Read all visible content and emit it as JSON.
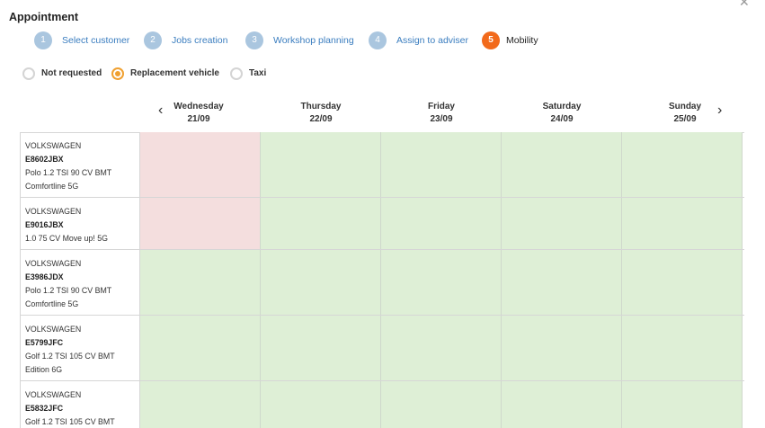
{
  "header": {
    "title": "Appointment",
    "close_icon": "close-icon"
  },
  "steps": [
    {
      "num": "1",
      "label": "Select customer",
      "active": false
    },
    {
      "num": "2",
      "label": "Jobs creation",
      "active": false
    },
    {
      "num": "3",
      "label": "Workshop planning",
      "active": false
    },
    {
      "num": "4",
      "label": "Assign to adviser",
      "active": false
    },
    {
      "num": "5",
      "label": "Mobility",
      "active": true
    }
  ],
  "mobility_options": [
    {
      "label": "Not requested",
      "selected": false
    },
    {
      "label": "Replacement vehicle",
      "selected": true
    },
    {
      "label": "Taxi",
      "selected": false
    }
  ],
  "calendar": {
    "prev_icon": "chevron-left-icon",
    "next_icon": "chevron-right-icon",
    "days": [
      {
        "name": "Wednesday",
        "date": "21/09"
      },
      {
        "name": "Thursday",
        "date": "22/09"
      },
      {
        "name": "Friday",
        "date": "23/09"
      },
      {
        "name": "Saturday",
        "date": "24/09"
      },
      {
        "name": "Sunday",
        "date": "25/09"
      }
    ]
  },
  "vehicles": [
    {
      "brand": "VOLKSWAGEN",
      "plate": "E8602JBX",
      "model": "Polo 1.2 TSI 90 CV BMT",
      "trim": "Comfortline 5G",
      "availability": [
        "busy",
        "free",
        "free",
        "free",
        "free"
      ]
    },
    {
      "brand": "VOLKSWAGEN",
      "plate": "E9016JBX",
      "model": "1.0 75 CV Move up! 5G",
      "trim": "",
      "availability": [
        "busy",
        "free",
        "free",
        "free",
        "free"
      ]
    },
    {
      "brand": "VOLKSWAGEN",
      "plate": "E3986JDX",
      "model": "Polo 1.2 TSI 90 CV BMT",
      "trim": "Comfortline 5G",
      "availability": [
        "free",
        "free",
        "free",
        "free",
        "free"
      ]
    },
    {
      "brand": "VOLKSWAGEN",
      "plate": "E5799JFC",
      "model": "Golf 1.2 TSI 105 CV BMT",
      "trim": "Edition 6G",
      "availability": [
        "free",
        "free",
        "free",
        "free",
        "free"
      ]
    },
    {
      "brand": "VOLKSWAGEN",
      "plate": "E5832JFC",
      "model": "Golf 1.2 TSI 105 CV BMT",
      "trim": "",
      "availability": [
        "free",
        "free",
        "free",
        "free",
        "free"
      ]
    }
  ],
  "colors": {
    "accent": "#f26a1b",
    "step_inactive": "#aac6df",
    "link": "#3a7dbf",
    "available": "#deefd6",
    "unavailable": "#f4dede",
    "radio_checked": "#f0a030"
  }
}
